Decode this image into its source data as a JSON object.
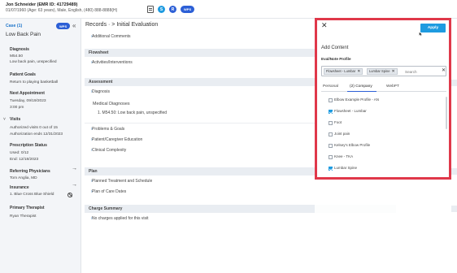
{
  "header": {
    "patient_name": "Jon Schneider (EMR ID: 41729489)",
    "patient_meta": "01/07/1960 (Age: 63 years), Male, English, (480) 888-8888(H)",
    "circle1": "S",
    "circle2": "R",
    "pill": "WPS"
  },
  "sidebar": {
    "case_label": "Case (1)",
    "case_pill": "WPS",
    "collapse": "«",
    "case_title": "Low Back Pain",
    "diagnosis_h": "Diagnosis",
    "diagnosis_code": "M54.50",
    "diagnosis_text": "Low back pain, unspecified",
    "goals_h": "Patient Goals",
    "goals_text": "Return to playing basketball",
    "next_appt_h": "Next Appointment",
    "next_appt_date": "Tuesday, 09/19/2023",
    "next_appt_time": "3:00 pm",
    "visits_h": "Visits",
    "visits_line1": "Authorized visits 0 out of 15",
    "visits_line2": "Authorization ends 12/31/2023",
    "rx_h": "Prescription Status",
    "rx_used": "Used: 0/12",
    "rx_end": "End: 12/18/2023",
    "phys_h": "Referring Physicians",
    "phys_name": "Tom Anglia, MD",
    "ins_h": "Insurance",
    "ins_name": "1. Blue Cross Blue Shield",
    "therapist_h": "Primary Therapist",
    "therapist_name": "Ryan Therapist"
  },
  "main": {
    "breadcrumb": "Records  ·  > Initial Evaluation",
    "rows": {
      "additional_comments": "Additional Comments",
      "flowsheet_h": "Flowsheet",
      "activities": "Activities/Interventions",
      "assessment_h": "Assessment",
      "diagnosis": "Diagnosis",
      "medical_diagnoses": "Medical Diagnoses",
      "diag_line": "1. M54.50: Low back pain, unspecified",
      "problems": "Problems & Goals",
      "education": "Patient/Caregiver Education",
      "complexity": "Clinical Complexity",
      "plan_h": "Plan",
      "planned": "Planned Treatment and Schedule",
      "plan_dates": "Plan of Care Dates",
      "charge_h": "Charge Summary",
      "no_charges": "No charges applied for this visit"
    }
  },
  "modal": {
    "close": "✕",
    "apply": "Apply",
    "title": "Add Content",
    "profile_label": "Eval/Note Profile",
    "chips": [
      "Flowsheet - Lumbar",
      "Lumbar Spine"
    ],
    "search_placeholder": "Search",
    "clear": "✕",
    "tabs": [
      "Personal",
      "(2) Company",
      "WebPT"
    ],
    "options": [
      {
        "label": "Elbow Example Profile - AN",
        "checked": false
      },
      {
        "label": "Flowsheet - Lumbar",
        "checked": true
      },
      {
        "label": "Foot",
        "checked": false
      },
      {
        "label": "Joint pain",
        "checked": false
      },
      {
        "label": "Kelsey's Elbow Profile",
        "checked": false
      },
      {
        "label": "Knee - TKA",
        "checked": false
      },
      {
        "label": "Lumbar Spine",
        "checked": true
      }
    ]
  },
  "colors": {
    "accent": "#1e9be0",
    "brand": "#2c5fd6",
    "highlight_border": "#e0384a"
  }
}
